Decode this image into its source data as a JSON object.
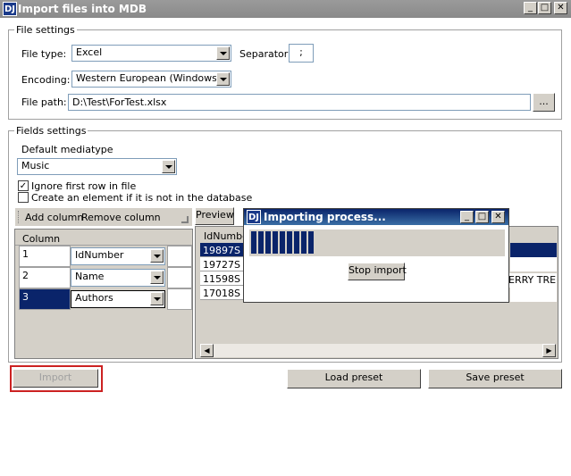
{
  "window": {
    "title": "Import files into MDB",
    "logo_text": "DJ",
    "min": "_",
    "max": "□",
    "close": "✕"
  },
  "file_settings": {
    "group_title": "File settings",
    "file_type_label": "File type:",
    "file_type_value": "Excel",
    "separator_label": "Separator",
    "separator_value": ";",
    "encoding_label": "Encoding:",
    "encoding_value": "Western European (Windows)",
    "file_path_label": "File path:",
    "file_path_value": "D:\\Test\\ForTest.xlsx",
    "browse_label": "..."
  },
  "fields_settings": {
    "group_title": "Fields settings",
    "default_mediatype_label": "Default mediatype",
    "mediatype_value": "Music",
    "ignore_first_row_label": "Ignore first row in file",
    "ignore_first_row_checked": true,
    "create_element_label": "Create an element if it is not in the database",
    "create_element_checked": false,
    "add_column_label": "Add column",
    "remove_column_label": "Remove column",
    "column_header": "Column",
    "columns": [
      {
        "num": "1",
        "field": "IdNumber",
        "selected": false
      },
      {
        "num": "2",
        "field": "Name",
        "selected": false
      },
      {
        "num": "3",
        "field": "Authors",
        "selected": true
      }
    ],
    "preview_tab_label": "Preview",
    "preview_header": "IdNumbe",
    "preview_rows": [
      "19897S",
      "19727S",
      "11598S",
      "17018S"
    ],
    "preview_overflow_text": "ERRY TREE"
  },
  "progress_dialog": {
    "logo_text": "DJ",
    "title": "Importing process...",
    "min": "_",
    "max": "□",
    "close": "✕",
    "progress_percent": 25,
    "stop_label": "Stop import"
  },
  "footer": {
    "import_label": "Import",
    "load_preset_label": "Load preset",
    "save_preset_label": "Save preset"
  }
}
